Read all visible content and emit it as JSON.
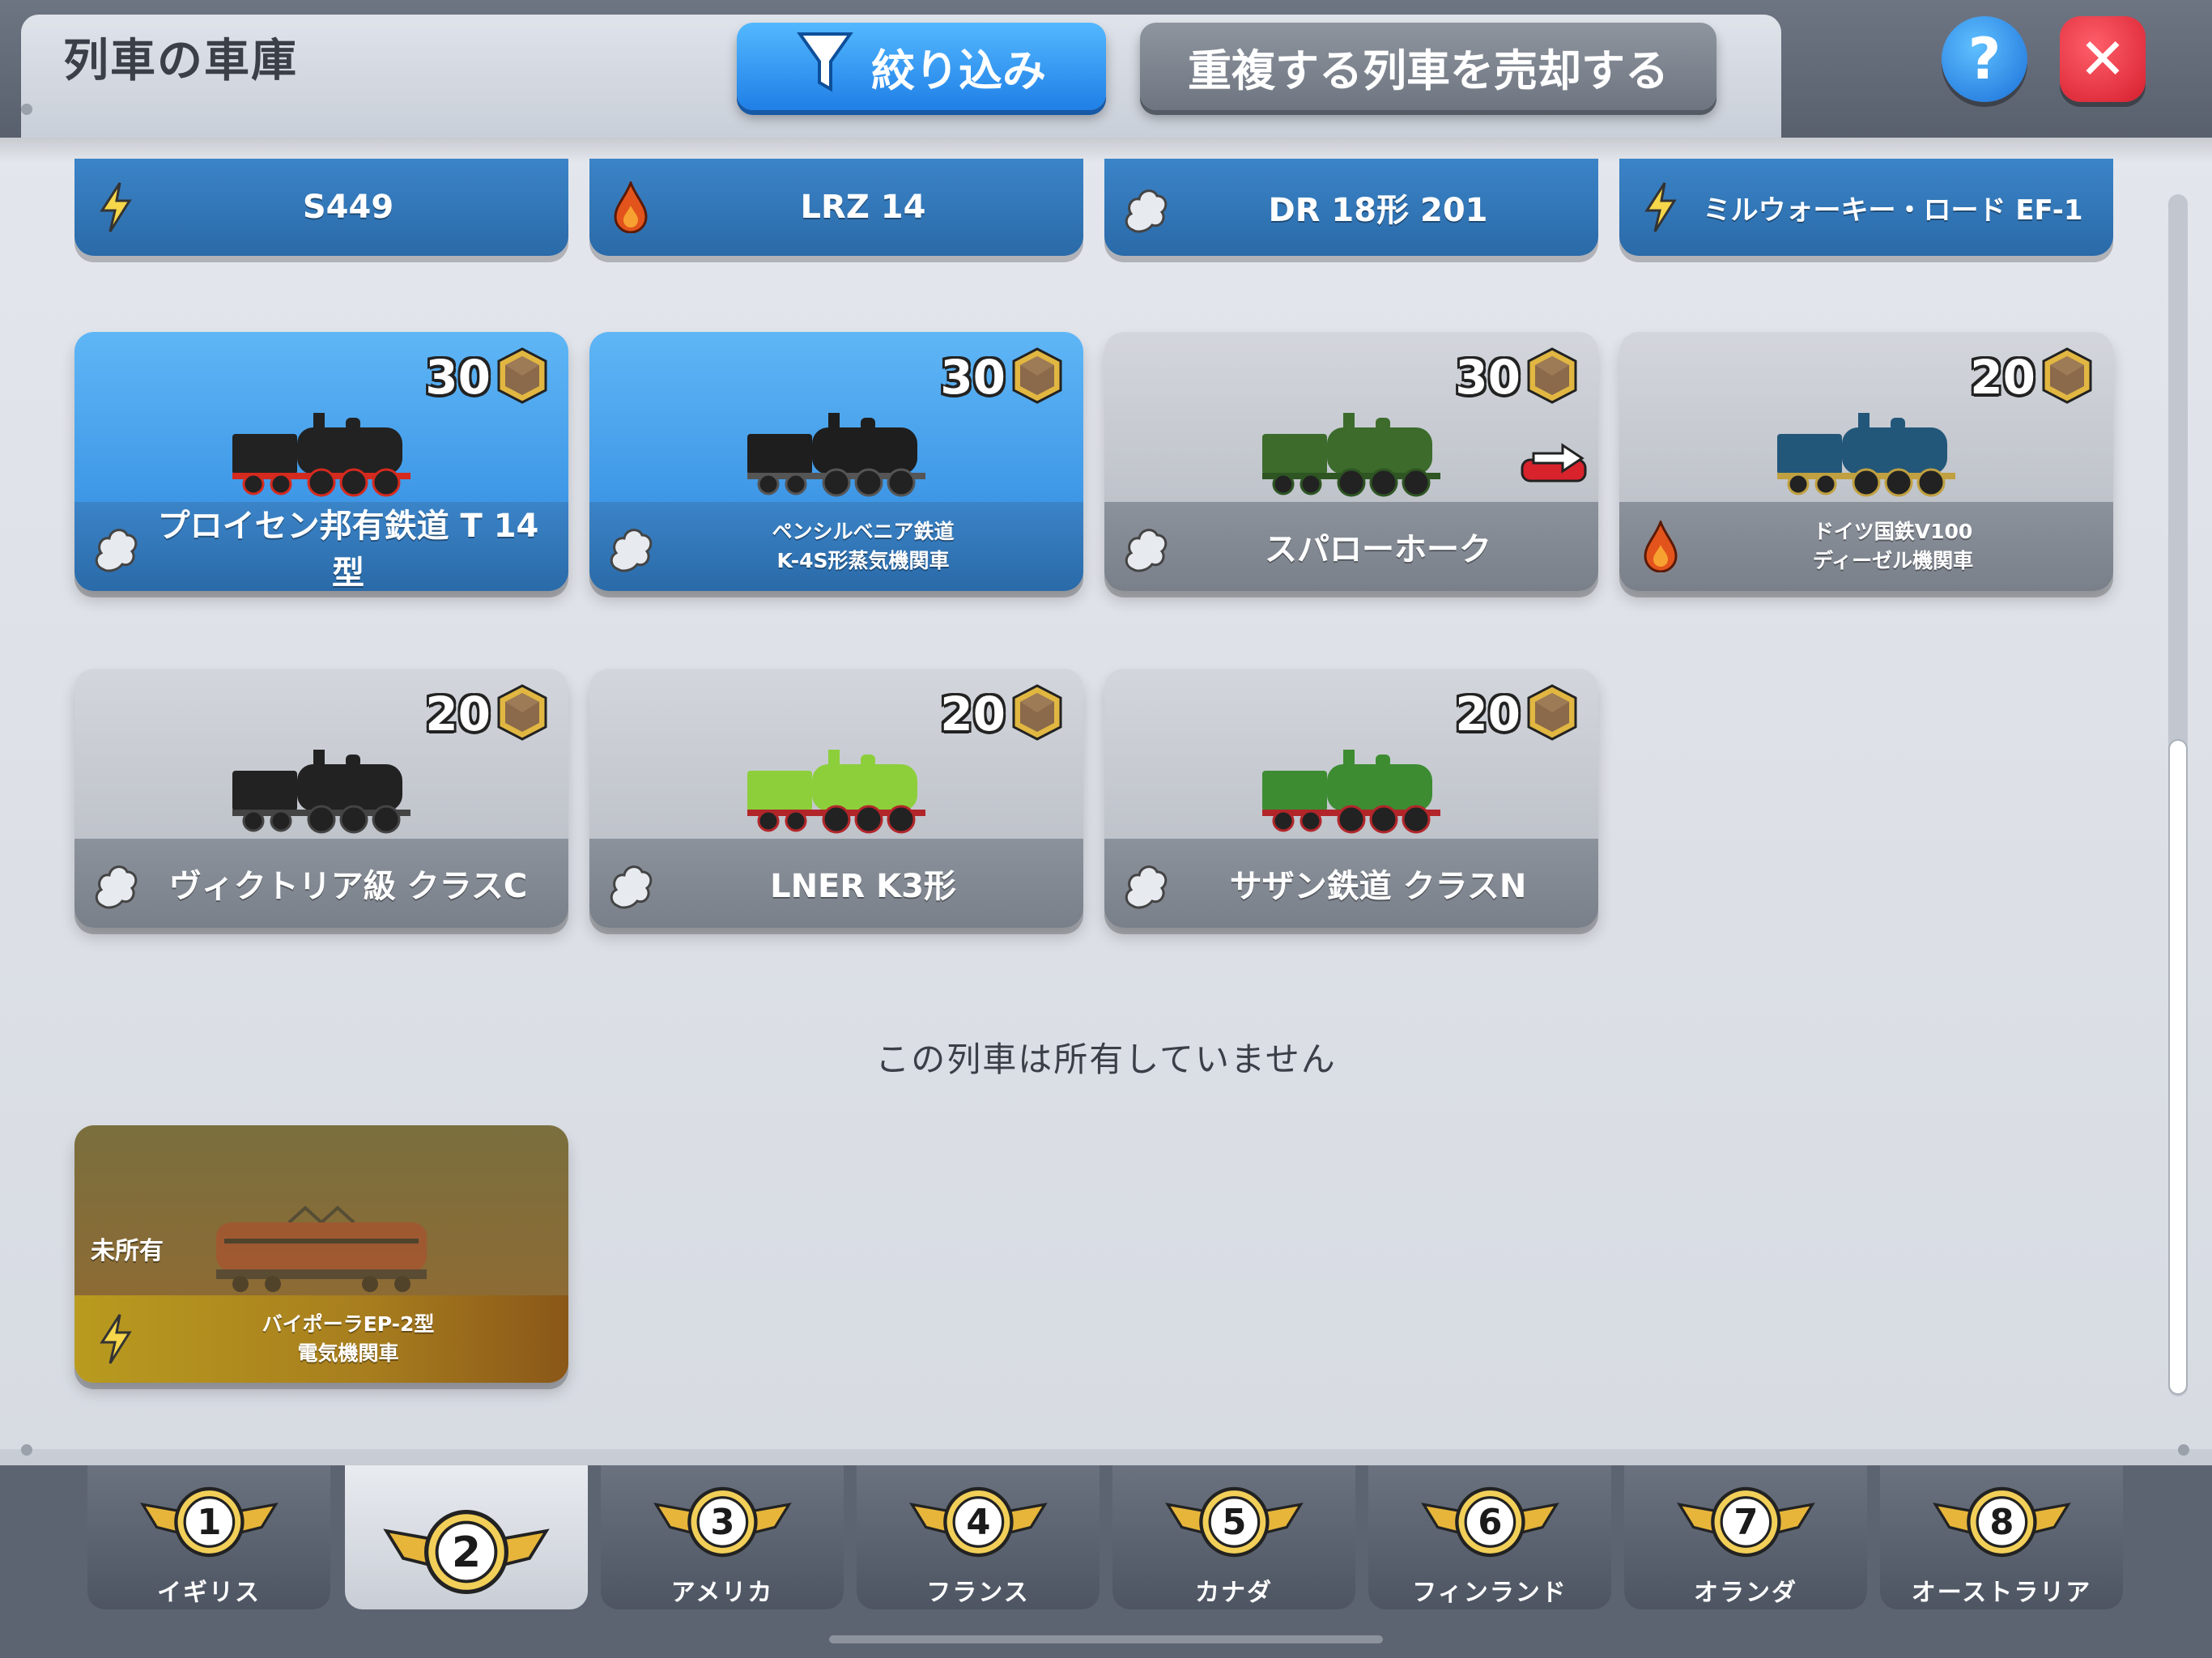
{
  "header": {
    "title": "列車の車庫",
    "filter_label": "絞り込み",
    "sell_label": "重複する列車を売却する",
    "help_label": "?",
    "close_label": "✕"
  },
  "top_strip": [
    {
      "name": "S449",
      "power": "lightning-icon"
    },
    {
      "name": "LRZ 14",
      "power": "fire-icon"
    },
    {
      "name": "DR 18形 201",
      "power": "steam-icon"
    },
    {
      "name": "ミルウォーキー・ロード EF-1",
      "power": "lightning-icon"
    }
  ],
  "cards": [
    {
      "name": "プロイセン邦有鉄道 T 14型",
      "level": "30",
      "power": "steam-icon",
      "style": "blue",
      "train_color": "#222",
      "accent": "#d52a1e"
    },
    {
      "name_line1": "ペンシルベニア鉄道",
      "name_line2": "K-4S形蒸気機関車",
      "level": "30",
      "power": "steam-icon",
      "style": "blue",
      "train_color": "#1e1e1e",
      "accent": "#555"
    },
    {
      "name": "スパローホーク",
      "level": "30",
      "power": "steam-icon",
      "style": "grey",
      "train_color": "#3c6b2c",
      "accent": "#2e5522"
    },
    {
      "name_line1": "ドイツ国鉄V100",
      "name_line2": "ディーゼル機関車",
      "level": "20",
      "power": "fire-icon",
      "style": "grey",
      "train_color": "#23577a",
      "accent": "#c0a040"
    },
    {
      "name": "ヴィクトリア級 クラスC",
      "level": "20",
      "power": "steam-icon",
      "style": "grey",
      "train_color": "#222",
      "accent": "#444"
    },
    {
      "name": "LNER K3形",
      "level": "20",
      "power": "steam-icon",
      "style": "grey",
      "train_color": "#8ccf3a",
      "accent": "#b2262a"
    },
    {
      "name": "サザン鉄道 クラスN",
      "level": "20",
      "power": "steam-icon",
      "style": "grey",
      "train_color": "#3d8c32",
      "accent": "#b2262a"
    }
  ],
  "notice": "この列車は所有していません",
  "unowned_card": {
    "badge": "未所有",
    "name_line1": "バイポーラEP-2型",
    "name_line2": "電気機関車",
    "power": "lightning-icon"
  },
  "tabs": [
    {
      "number": "1",
      "label": "イギリス",
      "active": false
    },
    {
      "number": "2",
      "label": "",
      "active": true
    },
    {
      "number": "3",
      "label": "アメリカ",
      "active": false
    },
    {
      "number": "4",
      "label": "フランス",
      "active": false
    },
    {
      "number": "5",
      "label": "カナダ",
      "active": false
    },
    {
      "number": "6",
      "label": "フィンランド",
      "active": false
    },
    {
      "number": "7",
      "label": "オランダ",
      "active": false
    },
    {
      "number": "8",
      "label": "オーストラリア",
      "active": false
    }
  ],
  "colors": {
    "accent_blue": "#2a8af0",
    "danger_red": "#e52a36",
    "gold": "#e6b53a"
  }
}
